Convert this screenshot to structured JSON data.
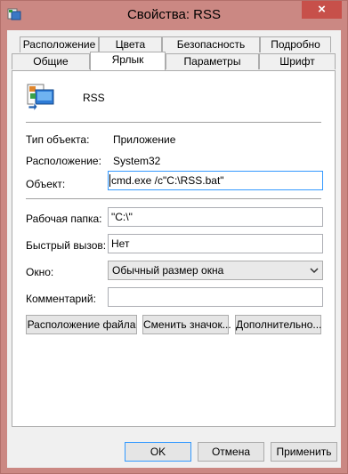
{
  "window": {
    "title": "Свойства: RSS",
    "close_glyph": "×"
  },
  "tabs": {
    "row_top": [
      "Расположение",
      "Цвета",
      "Безопасность",
      "Подробно"
    ],
    "row_bottom": [
      "Общие",
      "Ярлык",
      "Параметры",
      "Шрифт"
    ],
    "active": "Ярлык"
  },
  "shortcut": {
    "name": "RSS",
    "type_label": "Тип объекта:",
    "type_value": "Приложение",
    "location_label": "Расположение:",
    "location_value": "System32",
    "target_label": "Объект:",
    "target_value": "cmd.exe /c\"C:\\RSS.bat\"",
    "workdir_label": "Рабочая папка:",
    "workdir_value": "\"C:\\\"",
    "hotkey_label": "Быстрый вызов:",
    "hotkey_value": "Нет",
    "window_label": "Окно:",
    "window_value": "Обычный размер окна",
    "comment_label": "Комментарий:",
    "comment_value": ""
  },
  "actions": {
    "open_location": "Расположение файла",
    "change_icon": "Сменить значок...",
    "advanced": "Дополнительно..."
  },
  "footer": {
    "ok": "OK",
    "cancel": "Отмена",
    "apply": "Применить"
  },
  "colors": {
    "frame": "#cb8883",
    "close": "#c7504a",
    "focus": "#3399ff"
  },
  "icons": {
    "title": "cmd-shortcut-icon",
    "file": "batch-file-icon",
    "dropdown": "chevron-down-icon"
  }
}
